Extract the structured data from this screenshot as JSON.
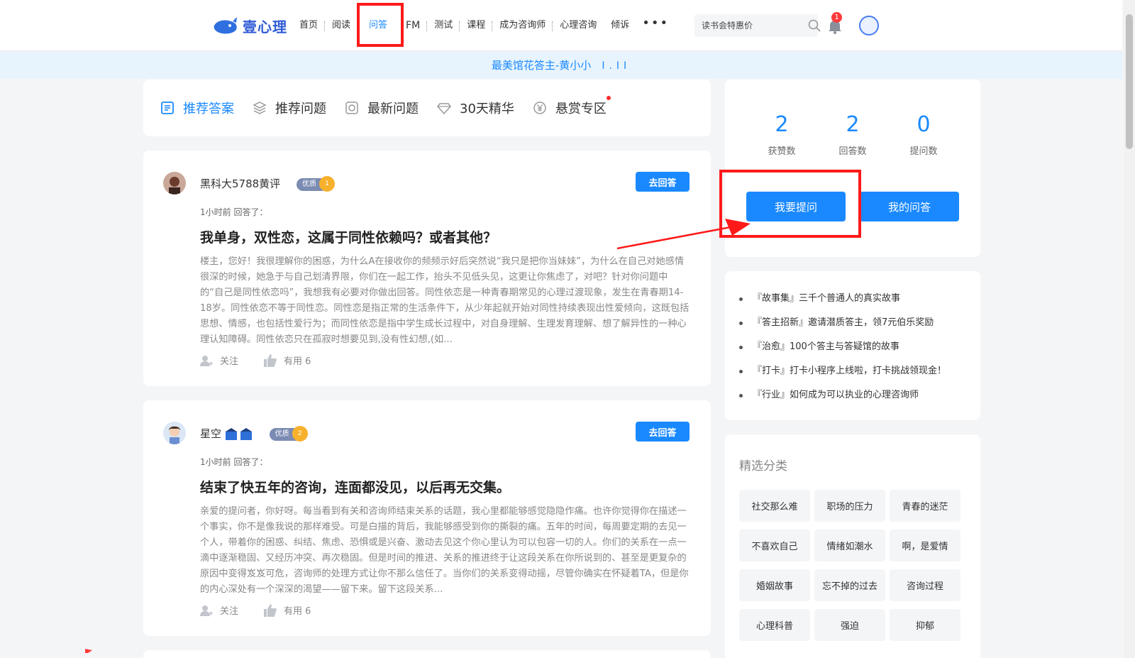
{
  "header": {
    "logo_text": "壹心理",
    "nav": [
      "首页",
      "阅读",
      "问答",
      "FM",
      "测试",
      "课程",
      "成为咨询师",
      "心理咨询",
      "倾诉"
    ],
    "more_label": "•••",
    "search_placeholder": "读书会特惠价",
    "notification_count": "1"
  },
  "banner": {
    "text": "最美馆花答主-黄小小",
    "bars": "I.II"
  },
  "tabs": [
    "推荐答案",
    "推荐问题",
    "最新问题",
    "30天精华",
    "悬赏专区"
  ],
  "answers": [
    {
      "user": "黑科大5788黄评",
      "badge": "优质",
      "badge_level": "1",
      "go_answer": "去回答",
      "time": "1小时前 回答了：",
      "title": "我单身，双性恋，这属于同性依赖吗？或者其他？",
      "excerpt": "楼主，您好！我很理解你的困惑，为什么A在接收你的频频示好后突然说“我只是把你当妹妹”，为什么在自己对她感情很深的时候，她急于与自己划清界限，你们在一起工作，抬头不见低头见，这更让你焦虑了，对吧？针对你问题中的“自己是同性依恋吗”，我想我有必要对你做出回答。同性依恋是一种青春期常见的心理过渡现象，发生在青春期14-18岁。同性依恋不等于同性恋。同性恋是指正常的生活条件下，从少年起就开始对同性持续表现出性爱倾向，这既包括思想、情感，也包括性爱行为；而同性依恋是指中学生成长过程中，对自身理解、生理发育理解、想了解异性的一种心理认知障碍。同性依恋只在孤寂时想要见到,没有性幻想,(如...",
      "follow": "关注",
      "useful": "有用 6"
    },
    {
      "user": "星空",
      "badge": "优质",
      "badge_level": "2",
      "go_answer": "去回答",
      "time": "1小时前 回答了：",
      "title": "结束了快五年的咨询，连面都没见，以后再无交集。",
      "excerpt": "亲爱的提问者，你好呀。每当看到有关和咨询师结束关系的话题，我心里都能够感觉隐隐作痛。也许你觉得你在描述一个事实，你不是像我说的那样难受。可是白描的背后，我能够感受到你的撕裂的痛。五年的时间，每周要定期的去见一个人，带着你的困惑、纠结、焦虑、恐惧或是兴奋、激动去见这个你心里认为可以包容一切的人。你们的关系在一点一滴中逐渐稳固、又经历冲突、再次稳固。但是时间的推进、关系的推进终于让这段关系在你所说到的、甚至是更复杂的原因中变得岌岌可危，咨询师的处理方式让你不那么信任了。当你们的关系变得动摇，尽管你确实在怀疑着TA，但是你的内心深处有一个深深的渴望——留下来。留下这段关系...",
      "follow": "关注",
      "useful": "有用 6"
    }
  ],
  "stats": [
    {
      "num": "2",
      "label": "获赞数"
    },
    {
      "num": "2",
      "label": "回答数"
    },
    {
      "num": "0",
      "label": "提问数"
    }
  ],
  "buttons": {
    "ask": "我要提问",
    "my": "我的问答"
  },
  "links": [
    "『故事集』三千个普通人的真实故事",
    "『答主招新』邀请潜质答主，领7元伯乐奖励",
    "『治愈』100个答主与答疑馆的故事",
    "『打卡』打卡小程序上线啦，打卡挑战领现金！",
    "『行业』如何成为可以执业的心理咨询师"
  ],
  "categories": {
    "title": "精选分类",
    "items": [
      "社交那么难",
      "职场的压力",
      "青春的迷茫",
      "不喜欢自己",
      "情绪如潮水",
      "啊，是爱情",
      "婚姻故事",
      "忘不掉的过去",
      "咨询过程",
      "心理科普",
      "强迫",
      "抑郁"
    ]
  },
  "colors": {
    "accent": "#1a89ff",
    "highlight": "#ff1a1a"
  }
}
